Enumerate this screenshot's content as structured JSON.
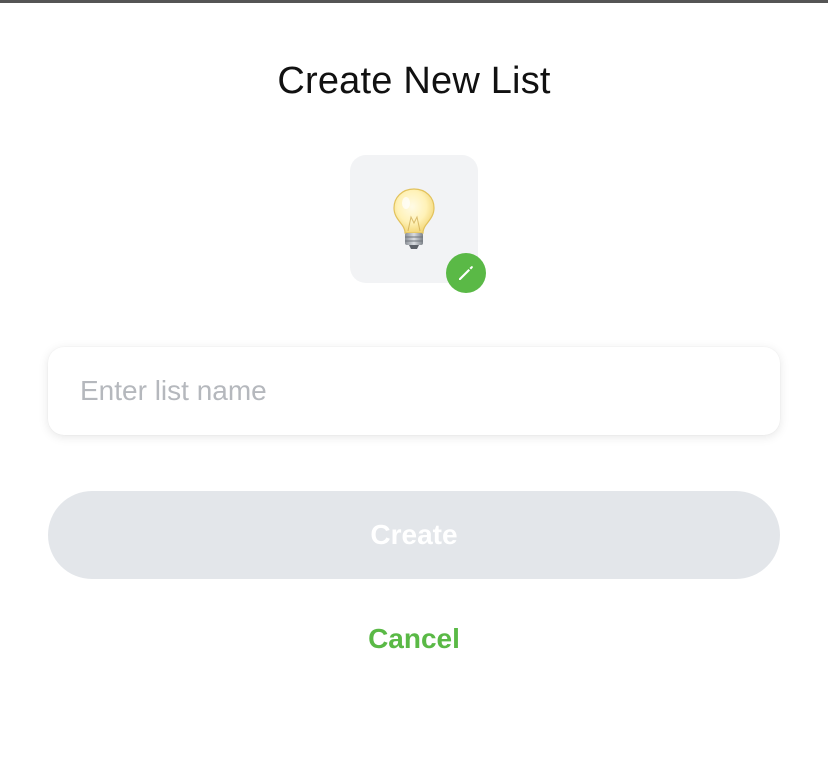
{
  "dialog": {
    "title": "Create New List",
    "icon": {
      "name": "light-bulb-icon",
      "edit_icon": "pencil-icon"
    },
    "name_input": {
      "value": "",
      "placeholder": "Enter list name"
    },
    "create_label": "Create",
    "cancel_label": "Cancel"
  },
  "colors": {
    "accent": "#5ab946",
    "disabled_button": "#e3e6ea",
    "icon_background": "#f2f3f5",
    "placeholder": "#b5b8bd"
  }
}
